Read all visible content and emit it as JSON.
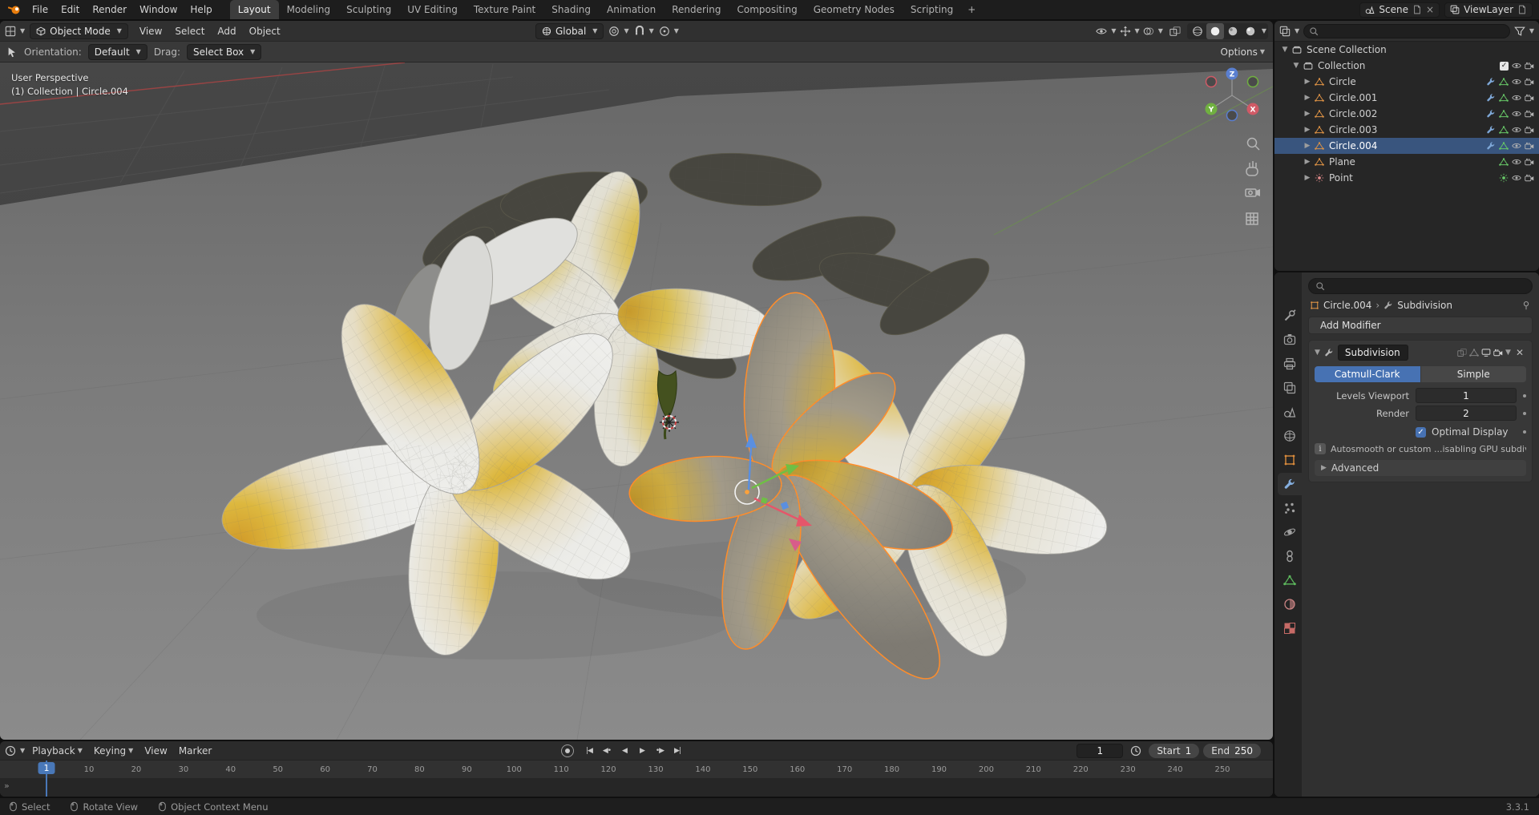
{
  "topbar": {
    "menus": [
      "File",
      "Edit",
      "Render",
      "Window",
      "Help"
    ],
    "workspaces": [
      "Layout",
      "Modeling",
      "Sculpting",
      "UV Editing",
      "Texture Paint",
      "Shading",
      "Animation",
      "Rendering",
      "Compositing",
      "Geometry Nodes",
      "Scripting"
    ],
    "active_workspace": "Layout",
    "add_workspace": "+",
    "scene_name": "Scene",
    "view_layer_name": "ViewLayer"
  },
  "viewport": {
    "header": {
      "mode": "Object Mode",
      "menus": [
        "View",
        "Select",
        "Add",
        "Object"
      ],
      "orientation": "Global",
      "options_label": "Options"
    },
    "tool_settings": {
      "orientation_label": "Orientation:",
      "orientation_value": "Default",
      "drag_label": "Drag:",
      "drag_value": "Select Box"
    },
    "overlay": {
      "perspective": "User Perspective",
      "context": "(1) Collection | Circle.004"
    },
    "axis": {
      "x": "X",
      "y": "Y",
      "z": "Z"
    }
  },
  "outliner": {
    "rows": [
      {
        "name": "Scene Collection"
      },
      {
        "name": "Collection"
      },
      {
        "name": "Circle"
      },
      {
        "name": "Circle.001"
      },
      {
        "name": "Circle.002"
      },
      {
        "name": "Circle.003"
      },
      {
        "name": "Circle.004"
      },
      {
        "name": "Plane"
      },
      {
        "name": "Point"
      }
    ],
    "selected": "Circle.004"
  },
  "properties": {
    "breadcrumb": {
      "object": "Circle.004",
      "separator": "›",
      "modifier": "Subdivision"
    },
    "add_modifier_label": "Add Modifier",
    "modifier": {
      "name": "Subdivision",
      "type_catmull": "Catmull-Clark",
      "type_simple": "Simple",
      "levels_label": "Levels Viewport",
      "levels_value": "1",
      "render_label": "Render",
      "render_value": "2",
      "optimal_display_label": "Optimal Display",
      "info_text": "Autosmooth or custom ...isabling GPU subdivision",
      "advanced_label": "Advanced"
    }
  },
  "timeline": {
    "menus": [
      {
        "label": "Playback",
        "caret": true
      },
      {
        "label": "Keying",
        "caret": true
      },
      {
        "label": "View",
        "caret": false
      },
      {
        "label": "Marker",
        "caret": false
      }
    ],
    "transport": [
      {
        "name": "jump-to-start",
        "glyph": "|◀"
      },
      {
        "name": "prev-keyframe",
        "glyph": "◀•"
      },
      {
        "name": "play-reverse",
        "glyph": "◀"
      },
      {
        "name": "play",
        "glyph": "▶"
      },
      {
        "name": "next-keyframe",
        "glyph": "•▶"
      },
      {
        "name": "jump-to-end",
        "glyph": "▶|"
      }
    ],
    "current_frame": "1",
    "start_label": "Start",
    "start_value": "1",
    "end_label": "End",
    "end_value": "250",
    "ticks": [
      1,
      10,
      20,
      30,
      40,
      50,
      60,
      70,
      80,
      90,
      100,
      110,
      120,
      130,
      140,
      150,
      160,
      170,
      180,
      190,
      200,
      210,
      220,
      230,
      240,
      250
    ]
  },
  "statusbar": {
    "items": [
      "Select",
      "Rotate View",
      "Object Context Menu"
    ],
    "version": "3.3.1"
  }
}
